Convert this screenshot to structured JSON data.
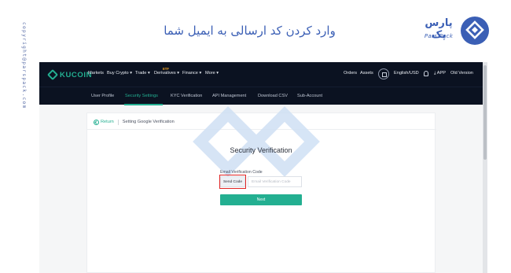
{
  "side": {
    "copyright": "copyright@parspack.com"
  },
  "header": {
    "title": "وارد کردن کد ارسالی به ایمیل شما"
  },
  "brand": {
    "name_fa": "پارس پک",
    "name_en": "Pars Pack"
  },
  "kucoin": {
    "logo": "KUCOIN",
    "nav": {
      "markets": "Markets",
      "buy_crypto": "Buy Crypto",
      "trade": "Trade",
      "derivatives": "Derivatives",
      "derivatives_badge": "ETF",
      "finance": "Finance",
      "more": "More",
      "orders": "Orders",
      "assets": "Assets",
      "language": "English/USD",
      "app": "APP",
      "old_version": "Old Version"
    },
    "subnav": {
      "user_profile": "User Profile",
      "security": "Security Settings",
      "kyc": "KYC Verification",
      "api": "API Management",
      "csv": "Download CSV",
      "sub_account": "Sub-Account"
    },
    "breadcrumb": {
      "return": "Return",
      "current": "Setting Google Verification"
    },
    "form": {
      "title": "Security Verification",
      "email_label": "Email Verification Code",
      "send_code": "Send Code",
      "code_placeholder": "Email Verification Code",
      "next": "Next"
    }
  },
  "colors": {
    "accent": "#23af91",
    "nav_bg": "#0b1221",
    "brand_blue": "#3b5fb5",
    "highlight_red": "#e02424"
  }
}
